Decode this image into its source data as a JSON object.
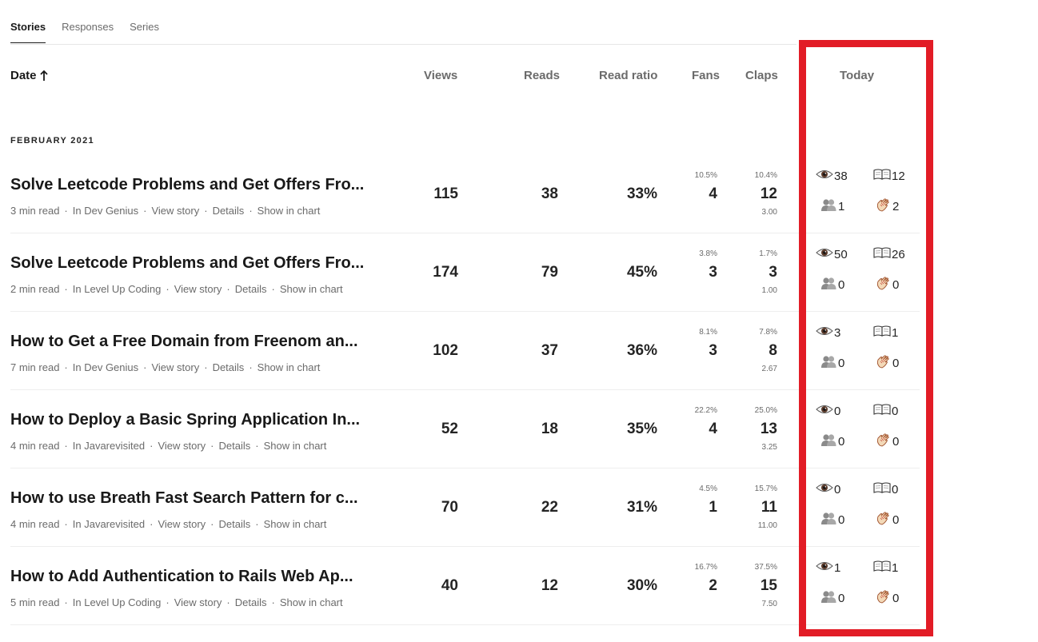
{
  "tabs": [
    {
      "label": "Stories"
    },
    {
      "label": "Responses"
    },
    {
      "label": "Series"
    }
  ],
  "columns": {
    "date": "Date",
    "views": "Views",
    "reads": "Reads",
    "read_ratio": "Read ratio",
    "fans": "Fans",
    "claps": "Claps",
    "today": "Today"
  },
  "month_label": "FEBRUARY 2021",
  "meta_links": {
    "view_story": "View story",
    "details": "Details",
    "show_in_chart": "Show in chart"
  },
  "rows": [
    {
      "title": "Solve Leetcode Problems and Get Offers Fro...",
      "read_time": "3 min read",
      "publication": "In Dev Genius",
      "views": "115",
      "reads": "38",
      "read_ratio": "33%",
      "fans_pct": "10.5%",
      "fans": "4",
      "claps_pct": "10.4%",
      "claps": "12",
      "claps_per_fan": "3.00",
      "today": {
        "views": "38",
        "reads": "12",
        "fans": "1",
        "claps": "2"
      }
    },
    {
      "title": "Solve Leetcode Problems and Get Offers Fro...",
      "read_time": "2 min read",
      "publication": "In Level Up Coding",
      "views": "174",
      "reads": "79",
      "read_ratio": "45%",
      "fans_pct": "3.8%",
      "fans": "3",
      "claps_pct": "1.7%",
      "claps": "3",
      "claps_per_fan": "1.00",
      "today": {
        "views": "50",
        "reads": "26",
        "fans": "0",
        "claps": "0"
      }
    },
    {
      "title": "How to Get a Free Domain from Freenom an...",
      "read_time": "7 min read",
      "publication": "In Dev Genius",
      "views": "102",
      "reads": "37",
      "read_ratio": "36%",
      "fans_pct": "8.1%",
      "fans": "3",
      "claps_pct": "7.8%",
      "claps": "8",
      "claps_per_fan": "2.67",
      "today": {
        "views": "3",
        "reads": "1",
        "fans": "0",
        "claps": "0"
      }
    },
    {
      "title": "How to Deploy a Basic Spring Application In...",
      "read_time": "4 min read",
      "publication": "In Javarevisited",
      "views": "52",
      "reads": "18",
      "read_ratio": "35%",
      "fans_pct": "22.2%",
      "fans": "4",
      "claps_pct": "25.0%",
      "claps": "13",
      "claps_per_fan": "3.25",
      "today": {
        "views": "0",
        "reads": "0",
        "fans": "0",
        "claps": "0"
      }
    },
    {
      "title": "How to use Breath Fast Search Pattern for c...",
      "read_time": "4 min read",
      "publication": "In Javarevisited",
      "views": "70",
      "reads": "22",
      "read_ratio": "31%",
      "fans_pct": "4.5%",
      "fans": "1",
      "claps_pct": "15.7%",
      "claps": "11",
      "claps_per_fan": "11.00",
      "today": {
        "views": "0",
        "reads": "0",
        "fans": "0",
        "claps": "0"
      }
    },
    {
      "title": "How to Add Authentication to Rails Web Ap...",
      "read_time": "5 min read",
      "publication": "In Level Up Coding",
      "views": "40",
      "reads": "12",
      "read_ratio": "30%",
      "fans_pct": "16.7%",
      "fans": "2",
      "claps_pct": "37.5%",
      "claps": "15",
      "claps_per_fan": "7.50",
      "today": {
        "views": "1",
        "reads": "1",
        "fans": "0",
        "claps": "0"
      }
    }
  ],
  "colors": {
    "highlight_box": "#e21c26",
    "text_primary": "#191919",
    "text_muted": "#6b6b6b"
  },
  "icons": {
    "views": "eye-icon",
    "reads": "book-icon",
    "fans": "fans-icon",
    "claps": "clap-icon"
  }
}
